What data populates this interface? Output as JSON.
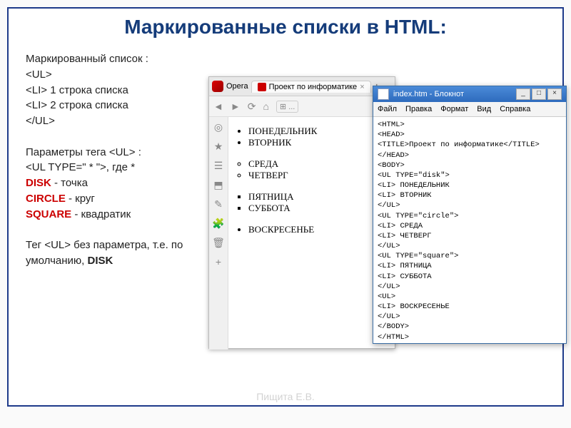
{
  "title": "Маркированные списки в HTML:",
  "left": {
    "heading": "Маркированный список :",
    "code": {
      "open_ul": "<UL>",
      "li1_tag": "<LI>",
      "li1_text": " 1 строка списка",
      "li2_tag": "<LI>",
      "li2_text": " 2 строка списка",
      "close_ul": "</UL>"
    },
    "params_heading_pre": "Параметры тега ",
    "params_heading_tag": "<UL>",
    "params_heading_post": " :",
    "type_line_pre": "<UL  TYPE=\" * \">",
    "type_line_post": ", где *",
    "disk_word": "DISK",
    "disk_desc": "  - точка",
    "circle_word": "CIRCLE",
    "circle_desc": "  - круг",
    "square_word": "SQUARE",
    "square_desc": "  - квадратик",
    "tail_pre": "Тег ",
    "tail_tag": "<UL>",
    "tail_mid": " без параметра, т.е. по умолчанию, ",
    "tail_bold": "DISK"
  },
  "browser": {
    "app_label": "Opera",
    "tab_label": "Проект по информатике",
    "list_disc": [
      "ПОНЕДЕЛЬНИК",
      "ВТОРНИК"
    ],
    "list_circle": [
      "СРЕДА",
      "ЧЕТВЕРГ"
    ],
    "list_square": [
      "ПЯТНИЦА",
      "СУББОТА"
    ],
    "list_last": [
      "ВОСКРЕСЕНЬЕ"
    ]
  },
  "notepad": {
    "title": "index.htm - Блокнот",
    "menu": [
      "Файл",
      "Правка",
      "Формат",
      "Вид",
      "Справка"
    ],
    "lines": [
      "<HTML>",
      "<HEAD>",
      "<TITLE>Проект по информатике</TITLE>",
      "</HEAD>",
      "<BODY>",
      "<UL TYPE=\"disk\">",
      "<LI> ПОНЕДЕЛЬНИК",
      "<LI> ВТОРНИК",
      "</UL>",
      "<UL TYPE=\"circle\">",
      "<LI> СРЕДА",
      "<LI> ЧЕТВЕРГ",
      "</UL>",
      "<UL TYPE=\"square\">",
      "<LI> ПЯТНИЦА",
      "<LI> СУББОТА",
      "</UL>",
      "<UL>",
      "<LI> ВОСКРЕСЕНЬЕ",
      "</UL>",
      "</BODY>",
      "</HTML>"
    ]
  },
  "footer": "Пищита Е.В."
}
